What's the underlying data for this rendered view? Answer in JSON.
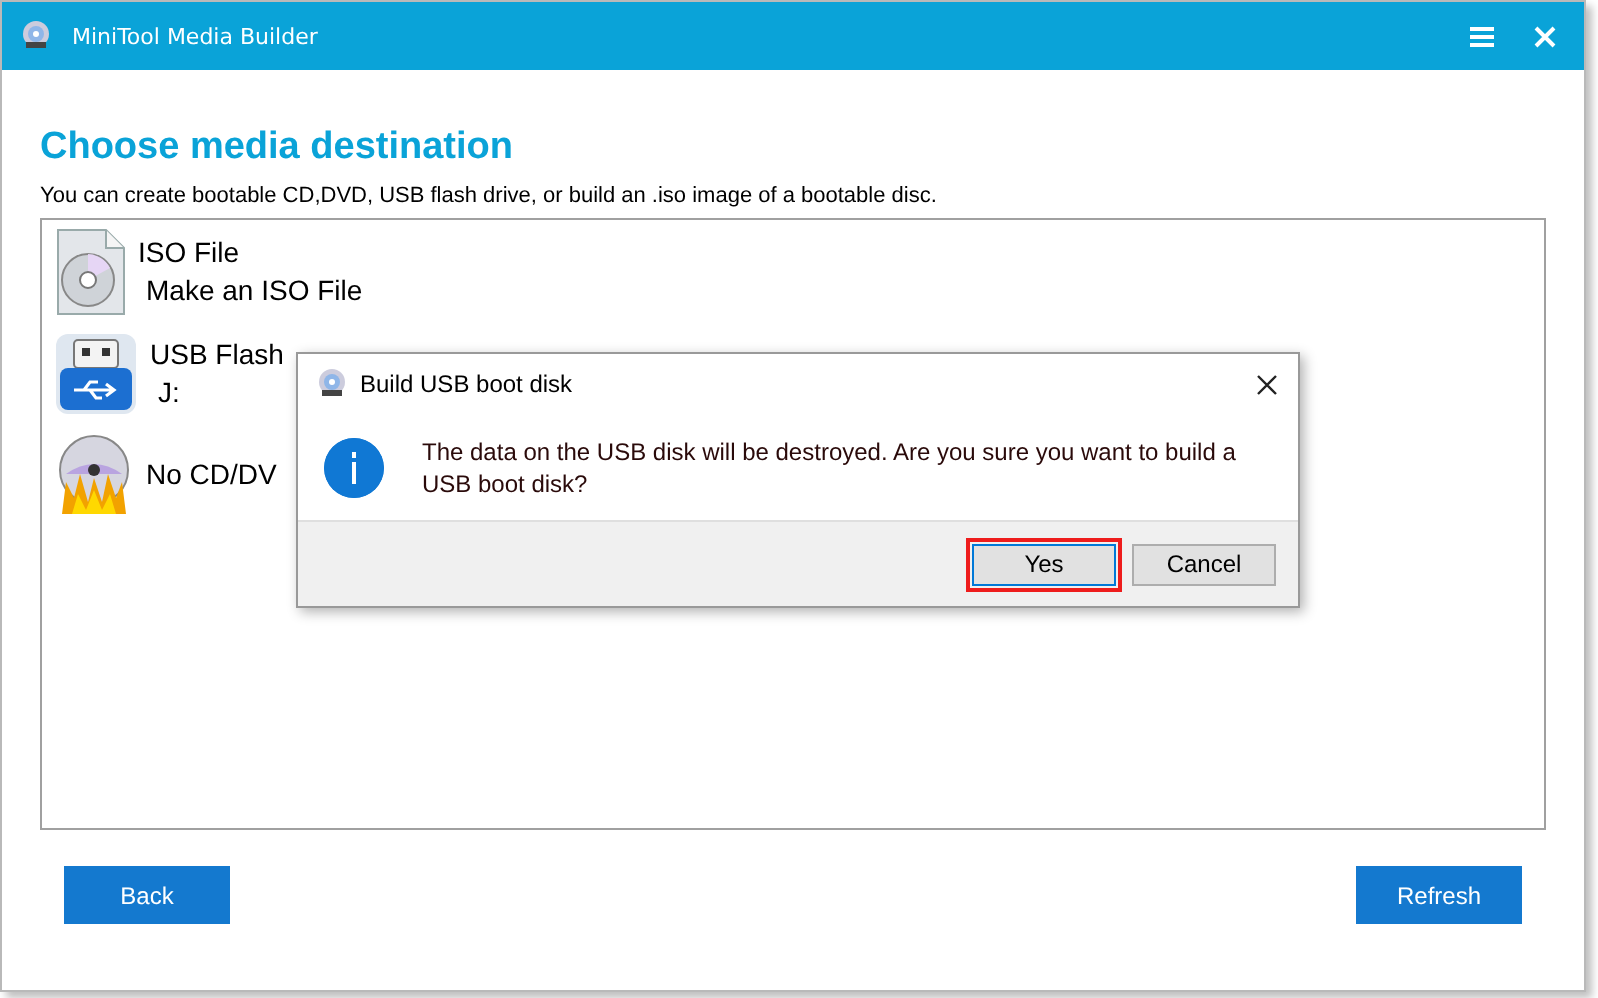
{
  "window": {
    "title": "MiniTool Media Builder",
    "controls": [
      {
        "kind": "menu"
      },
      {
        "kind": "close"
      }
    ]
  },
  "heading": "Choose media destination",
  "subtitle": "You can create bootable CD,DVD, USB flash drive, or build an .iso image of a bootable disc.",
  "media": [
    {
      "kind": "iso",
      "name": "ISO File",
      "detail": "Make an ISO File"
    },
    {
      "kind": "usb",
      "name": "USB Flash",
      "detail": "J:"
    },
    {
      "kind": "disc",
      "name": "No CD/DV"
    }
  ],
  "buttons": [
    {
      "label": "Back"
    },
    {
      "label": "Refresh"
    }
  ],
  "dialog": {
    "title": "Build USB boot disk",
    "message": "The data on the USB disk will be destroyed. Are you sure you want to build a USB boot disk?",
    "buttons": [
      {
        "label": "Yes",
        "highlighted": true
      },
      {
        "label": "Cancel",
        "highlighted": false
      }
    ]
  }
}
